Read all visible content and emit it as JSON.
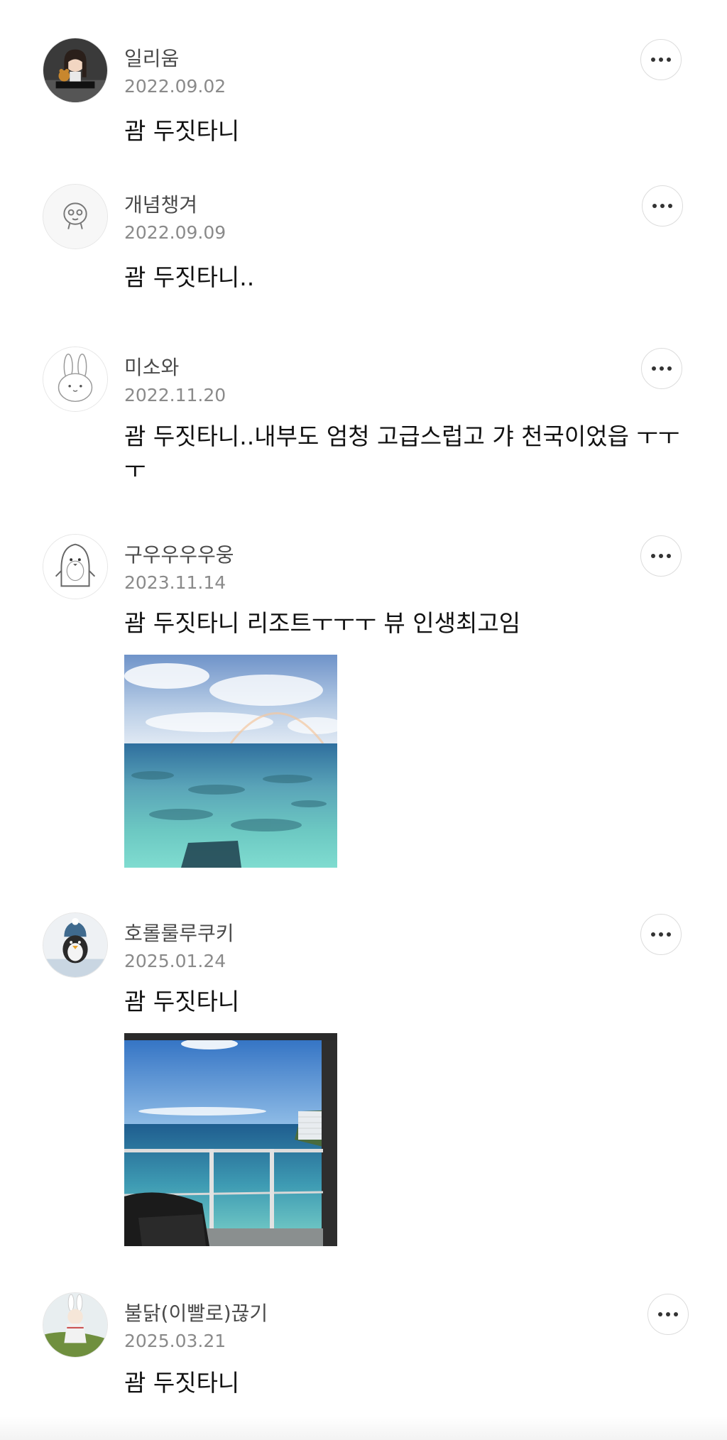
{
  "comments": [
    {
      "name": "일리움",
      "date": "2022.09.02",
      "text": "괌 두짓타니",
      "avatar_icon": "girl-with-bear-avatar-icon"
    },
    {
      "name": "개념챙겨",
      "date": "2022.09.09",
      "text": "괌 두짓타니..",
      "avatar_icon": "cartoon-face-avatar-icon"
    },
    {
      "name": "미소와",
      "date": "2022.11.20",
      "text": "괌 두짓타니..내부도 엄청 고급스럽고 갸 천국이었읍 ㅜㅜㅜ",
      "avatar_icon": "bunny-avatar-icon"
    },
    {
      "name": "구우우우우웅",
      "date": "2023.11.14",
      "text": "괌 두짓타니 리조트ㅜㅜㅜ 뷰 인생최고임",
      "avatar_icon": "penguin-avatar-icon",
      "photo": "ocean-rainbow-photo"
    },
    {
      "name": "호롤룰루쿠키",
      "date": "2025.01.24",
      "text": "괌 두짓타니",
      "avatar_icon": "penguin-plush-avatar-icon",
      "photo": "balcony-ocean-photo"
    },
    {
      "name": "불닭(이빨로)끊기",
      "date": "2025.03.21",
      "text": "괌 두짓타니",
      "avatar_icon": "bunny-doll-avatar-icon"
    }
  ],
  "more_button_icon": "more-dots-icon"
}
